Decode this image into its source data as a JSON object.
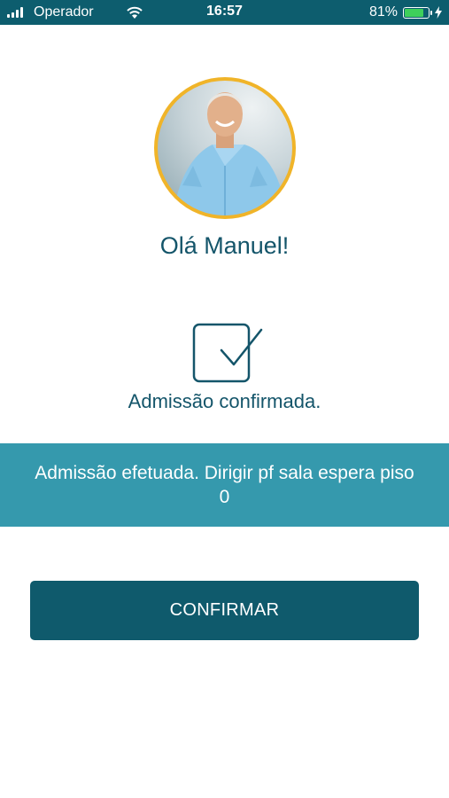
{
  "status_bar": {
    "carrier": "Operador",
    "time": "16:57",
    "battery_percent": "81%",
    "battery_level": 0.81,
    "signal_icon": "signal-bars-icon",
    "wifi_icon": "wifi-icon",
    "charging_icon": "charging-bolt-icon"
  },
  "profile": {
    "greeting": "Olá Manuel!",
    "avatar_icon": "user-photo-avatar",
    "avatar_ring_color": "#f0b429"
  },
  "status": {
    "icon": "checkbox-checked-icon",
    "message": "Admissão confirmada."
  },
  "banner": {
    "text": "Admissão efetuada. Dirigir pf sala espera piso 0",
    "color": "#3599ad"
  },
  "actions": {
    "confirm_label": "CONFIRMAR",
    "confirm_color": "#0f5a6c"
  },
  "colors": {
    "status_bar": "#0d5d6e",
    "text_primary": "#14556a"
  }
}
